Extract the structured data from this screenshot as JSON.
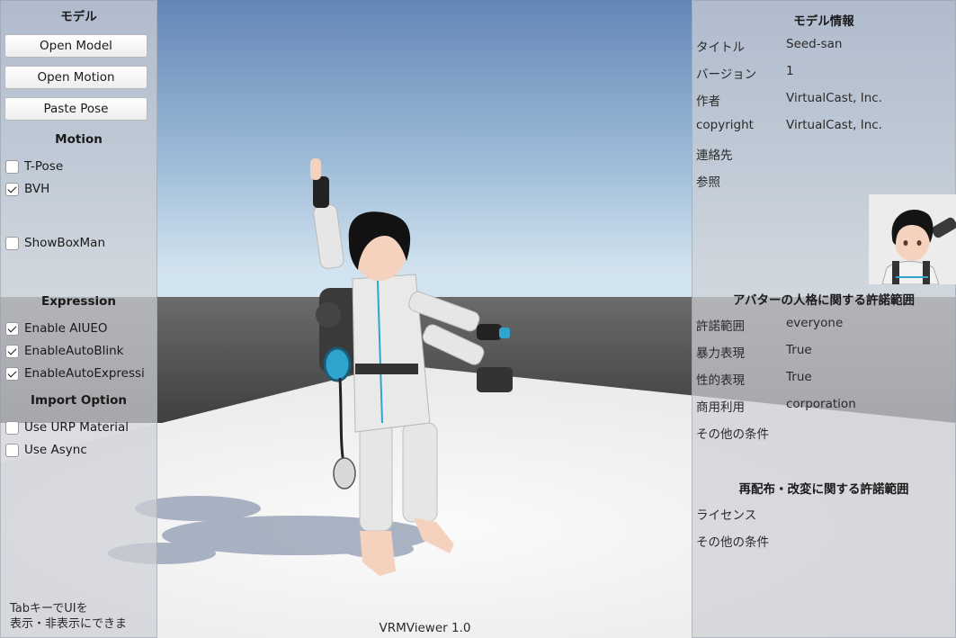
{
  "left_panel": {
    "title": "モデル",
    "buttons": {
      "open_model": "Open Model",
      "open_motion": "Open Motion",
      "paste_pose": "Paste Pose"
    },
    "motion": {
      "title": "Motion",
      "tpose": {
        "label": "T-Pose",
        "checked": false
      },
      "bvh": {
        "label": "BVH",
        "checked": true
      },
      "showboxman": {
        "label": "ShowBoxMan",
        "checked": false
      }
    },
    "expression": {
      "title": "Expression",
      "aiueo": {
        "label": "Enable AIUEO",
        "checked": true
      },
      "autoblink": {
        "label": "EnableAutoBlink",
        "checked": true
      },
      "autoexpression": {
        "label": "EnableAutoExpressi",
        "checked": true
      }
    },
    "import_option": {
      "title": "Import Option",
      "urp": {
        "label": "Use URP Material",
        "checked": false
      },
      "async": {
        "label": "Use Async",
        "checked": false
      }
    },
    "hint": {
      "line1": "TabキーでUIを",
      "line2": "表示・非表示にできま"
    }
  },
  "right_panel": {
    "title": "モデル情報",
    "info": {
      "title": {
        "key": "タイトル",
        "value": "Seed-san"
      },
      "version": {
        "key": "バージョン",
        "value": "1"
      },
      "author": {
        "key": "作者",
        "value": "VirtualCast, Inc."
      },
      "copyright": {
        "key": "copyright",
        "value": "VirtualCast, Inc."
      },
      "contact": {
        "key": "連絡先",
        "value": ""
      },
      "reference": {
        "key": "参照",
        "value": ""
      }
    },
    "persona": {
      "title": "アバターの人格に関する許諾範囲",
      "allowed_user": {
        "key": "許諾範囲",
        "value": "everyone"
      },
      "violence": {
        "key": "暴力表現",
        "value": "True"
      },
      "sexual": {
        "key": "性的表現",
        "value": "True"
      },
      "commercial": {
        "key": "商用利用",
        "value": "corporation"
      },
      "other": {
        "key": "その他の条件",
        "value": ""
      }
    },
    "redistribution": {
      "title": "再配布・改変に関する許諾範囲",
      "license": {
        "key": "ライセンス",
        "value": ""
      },
      "other": {
        "key": "その他の条件",
        "value": ""
      }
    }
  },
  "footer": {
    "version_label": "VRMViewer 1.0"
  },
  "colors": {
    "sky_top": "#6a8fbd",
    "horizon": "#d8e6f1",
    "far_floor": "#4c4c4c",
    "floor": "#f1f1f3",
    "shadow": "#8e9aad",
    "accent": "#2fa4cf"
  },
  "icons": {
    "checkbox_checked": "check-icon"
  }
}
